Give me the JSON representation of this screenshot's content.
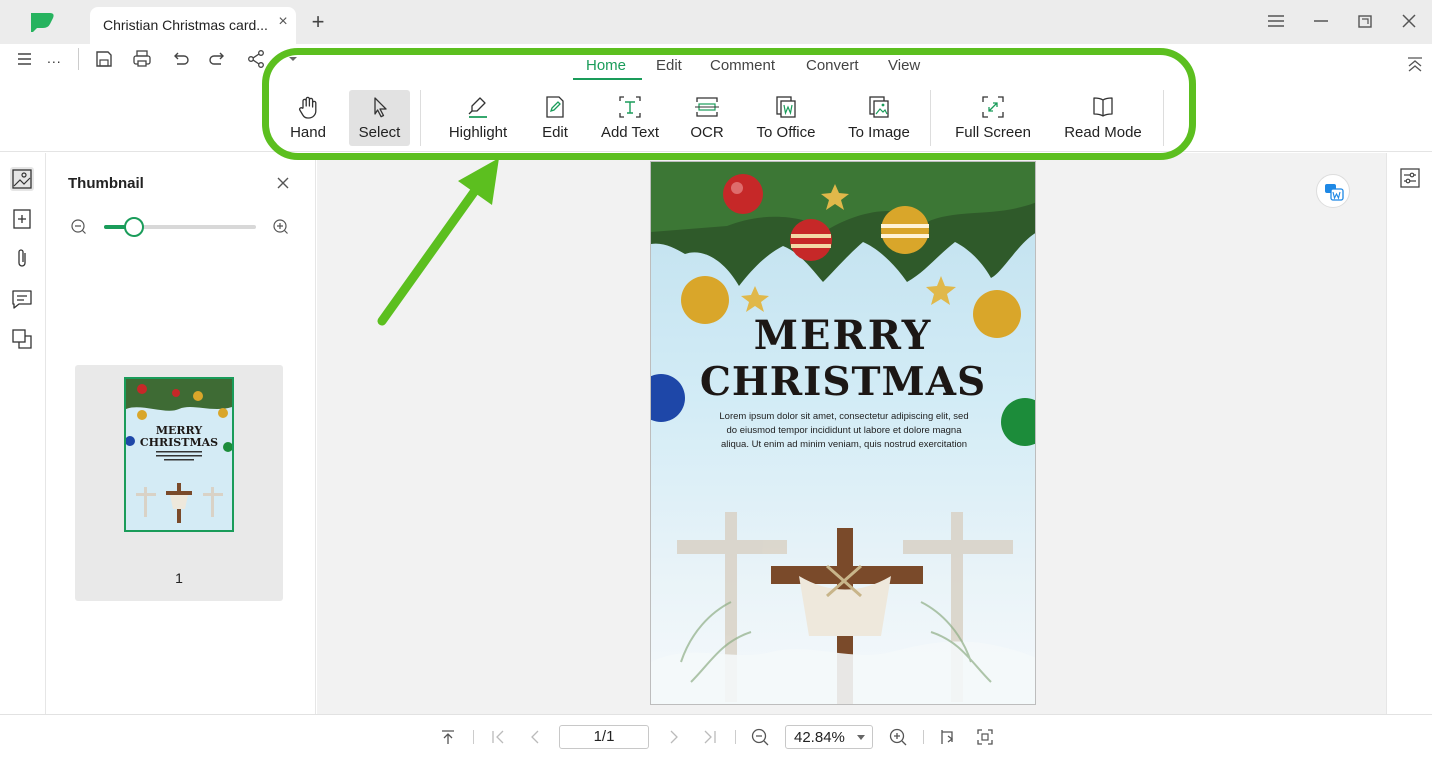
{
  "titlebar": {
    "logo_icon": "app-logo-icon",
    "tab_title": "Christian Christmas card...",
    "tab_close_icon": "close-icon",
    "new_tab_icon": "plus-icon",
    "window_controls": [
      "menu-icon",
      "minimize-icon",
      "restore-icon",
      "close-icon"
    ]
  },
  "quick_access": {
    "more_label": "...",
    "icons": [
      "hamburger-menu-icon",
      "save-icon",
      "print-icon",
      "undo-icon",
      "redo-icon",
      "share-icon",
      "dropdown-icon"
    ]
  },
  "menu_tabs": [
    {
      "label": "Home",
      "active": true
    },
    {
      "label": "Edit",
      "active": false
    },
    {
      "label": "Comment",
      "active": false
    },
    {
      "label": "Convert",
      "active": false
    },
    {
      "label": "View",
      "active": false
    }
  ],
  "tools": [
    {
      "label": "Hand",
      "icon": "hand-icon",
      "selected": false
    },
    {
      "label": "Select",
      "icon": "cursor-icon",
      "selected": true
    },
    {
      "label": "Highlight",
      "icon": "highlighter-icon",
      "selected": false
    },
    {
      "label": "Edit",
      "icon": "edit-icon",
      "selected": false
    },
    {
      "label": "Add Text",
      "icon": "add-text-icon",
      "selected": false
    },
    {
      "label": "OCR",
      "icon": "ocr-icon",
      "selected": false
    },
    {
      "label": "To Office",
      "icon": "to-office-icon",
      "selected": false
    },
    {
      "label": "To Image",
      "icon": "to-image-icon",
      "selected": false
    },
    {
      "label": "Full Screen",
      "icon": "full-screen-icon",
      "selected": false
    },
    {
      "label": "Read Mode",
      "icon": "book-icon",
      "selected": false
    }
  ],
  "left_rail": [
    "thumbnail-icon",
    "bookmark-add-icon",
    "attachment-icon",
    "comment-icon",
    "layers-icon"
  ],
  "thumbnail_panel": {
    "title": "Thumbnail",
    "zoom_level": 0.2,
    "page_number": "1",
    "mini_title_1": "MERRY",
    "mini_title_2": "CHRISTMAS"
  },
  "document": {
    "title_line1": "MERRY",
    "title_line2": "CHRISTMAS",
    "body_text": "Lorem ipsum dolor sit amet, consectetur adipiscing elit, sed do eiusmod tempor incididunt ut labore et dolore magna aliqua. Ut enim ad minim veniam, quis nostrud exercitation"
  },
  "statusbar": {
    "page_indicator": "1/1",
    "zoom_value": "42.84%"
  },
  "colors": {
    "accent": "#1a9c5a",
    "annotation": "#5cbf1f"
  }
}
